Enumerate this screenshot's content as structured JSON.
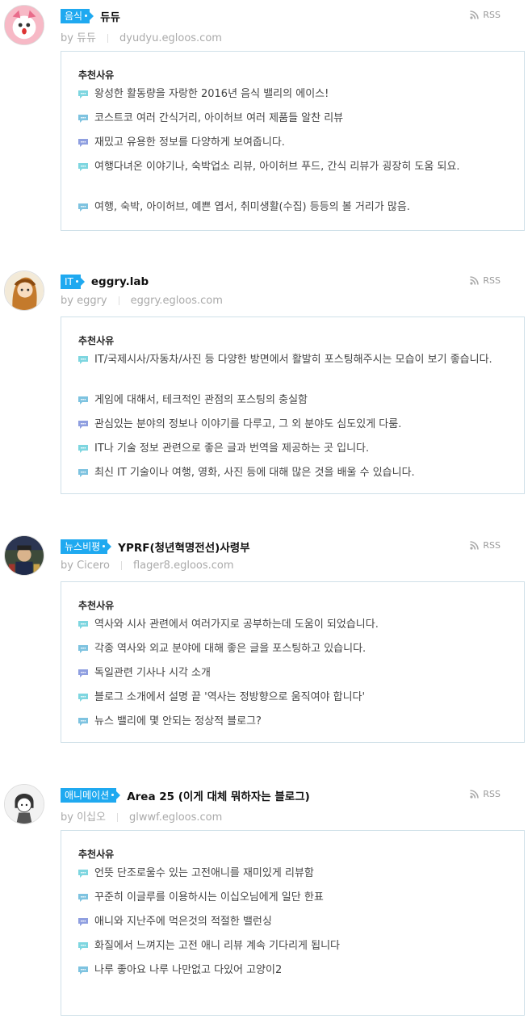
{
  "common": {
    "rss_label": "RSS",
    "reason_header": "추천사유",
    "accent": "#1fa9f0"
  },
  "blogs": [
    {
      "category": "음식",
      "title": "듀듀",
      "author": "by 듀듀",
      "url": "dyudyu.egloos.com",
      "reasons": [
        "왕성한 활동량을 자랑한 2016년 음식 밸리의 에이스!",
        "코스트코 여러 간식거리, 아이허브 여러 제품들 알찬 리뷰",
        "재밌고 유용한 정보를 다양하게 보여줍니다.",
        "여행다녀온 이야기나, 숙박업소 리뷰, 아이허브 푸드, 간식 리뷰가 굉장히 도움 되요.",
        "여행, 숙박, 아이허브, 예쁜 엽서, 취미생활(수집) 등등의 볼 거리가 많음."
      ]
    },
    {
      "category": "IT",
      "title": "eggry.lab",
      "author": "by eggry",
      "url": "eggry.egloos.com",
      "reasons": [
        "IT/국제시사/자동차/사진 등 다양한 방면에서 활발히 포스팅해주시는 모습이 보기 좋습니다.",
        "게임에 대해서, 테크적인 관점의 포스팅의 충실함",
        "관심있는 분야의 정보나 이야기를 다루고, 그 외 분야도 심도있게 다룸.",
        "IT나 기술 정보 관련으로 좋은 글과 번역을 제공하는 곳 입니다.",
        "최신 IT 기술이나 여행, 영화, 사진 등에 대해 많은 것을 배울 수 있습니다."
      ]
    },
    {
      "category": "뉴스비평",
      "title": "YPRF(청년혁명전선)사령부",
      "author": "by Cicero",
      "url": "flager8.egloos.com",
      "reasons": [
        "역사와 시사 관련에서 여러가지로 공부하는데 도움이 되었습니다.",
        "각종 역사와 외교 분야에 대해 좋은 글을 포스팅하고 있습니다.",
        "독일관련 기사나 시각 소개",
        "블로그 소개에서 설명 끝 '역사는 정방향으로 움직여야 합니다'",
        "뉴스 밸리에 몇 안되는 정상적 블로그?"
      ]
    },
    {
      "category": "애니메이션",
      "title": "Area 25 (이게 대체 뭐하자는 블로그)",
      "author": "by 이십오",
      "url": "glwwf.egloos.com",
      "reasons": [
        "언뜻 단조로울수 있는 고전애니를 재미있게 리뷰함",
        "꾸준히 이글루를 이용하시는 이십오님에게 일단 한표",
        "애니와 지난주에 먹은것의 적절한 밸런싱",
        "화질에서 느껴지는 고전 애니 리뷰 계속 기다리게 됩니다",
        "나루 좋아요 나루 나만없고 다있어 고양이2"
      ]
    }
  ]
}
